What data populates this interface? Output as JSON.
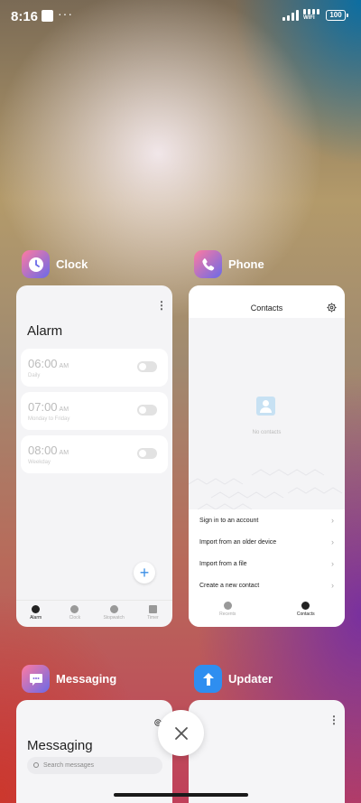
{
  "status_bar": {
    "time": "8:16",
    "more": "···",
    "wifi_label": "WIFI",
    "battery": "100"
  },
  "apps": {
    "clock": {
      "name": "Clock",
      "screen_title": "Alarm",
      "alarms": [
        {
          "time": "06:00",
          "ampm": "AM",
          "label": "Daily"
        },
        {
          "time": "07:00",
          "ampm": "AM",
          "label": "Monday to Friday"
        },
        {
          "time": "08:00",
          "ampm": "AM",
          "label": "Weekday"
        }
      ],
      "add_label": "+",
      "nav": [
        "Alarm",
        "Clock",
        "Stopwatch",
        "Timer"
      ]
    },
    "phone": {
      "name": "Phone",
      "screen_title": "Contacts",
      "empty_text": "No contacts",
      "actions": [
        "Sign in to an account",
        "Import from an older device",
        "Import from a file",
        "Create a new contact"
      ],
      "nav": [
        "Recents",
        "Contacts"
      ]
    },
    "messaging": {
      "name": "Messaging",
      "screen_title": "Messaging",
      "search_placeholder": "Search messages"
    },
    "updater": {
      "name": "Updater"
    }
  },
  "colors": {
    "accent_blue": "#3a8ee6",
    "updater_icon": "#2e8ef0",
    "card_bg": "#f4f4f6"
  }
}
